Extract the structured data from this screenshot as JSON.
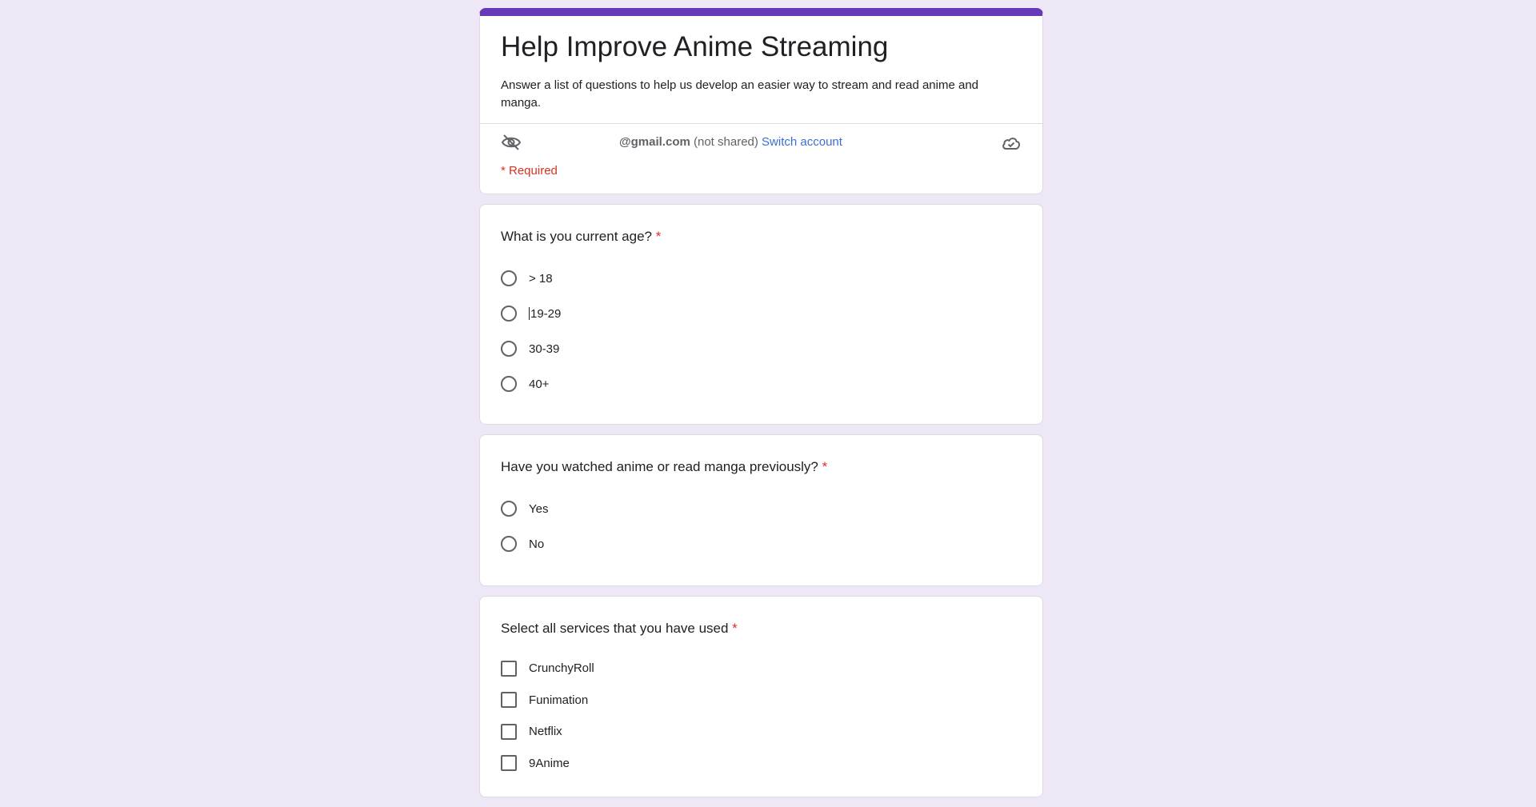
{
  "header": {
    "title": "Help Improve Anime Streaming",
    "description": "Answer a list of questions to help us develop an easier way to stream and read anime and manga.",
    "account_email": "@gmail.com",
    "not_shared": "(not shared)",
    "switch_account": "Switch account",
    "required_note": "* Required",
    "accent_color": "#673ab7"
  },
  "questions": [
    {
      "title": "What is you current age?",
      "required_mark": "*",
      "type": "radio",
      "options": [
        "> 18",
        "19-29",
        "30-39",
        "40+"
      ]
    },
    {
      "title": "Have you watched anime or read manga previously?",
      "required_mark": "*",
      "type": "radio",
      "options": [
        "Yes",
        "No"
      ]
    },
    {
      "title": "Select all services that you have used",
      "required_mark": "*",
      "type": "checkbox",
      "options": [
        "CrunchyRoll",
        "Funimation",
        "Netflix",
        "9Anime"
      ]
    }
  ],
  "icons": {
    "privacy": "eye-off-icon",
    "save": "cloud-done-icon"
  }
}
